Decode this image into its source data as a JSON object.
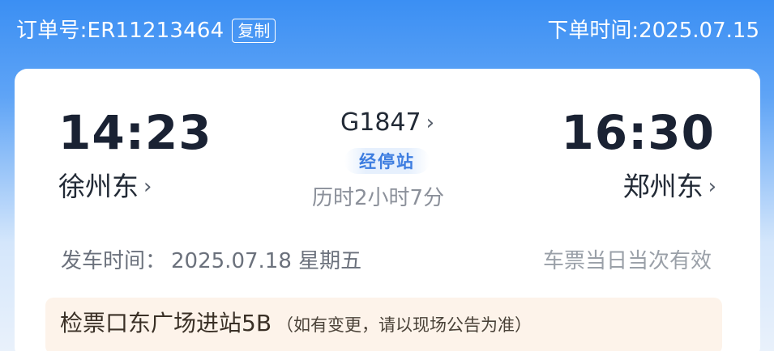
{
  "header": {
    "order_label": "订单号:ER11213464",
    "copy_label": "复制",
    "order_time": "下单时间:2025.07.15"
  },
  "trip": {
    "departure_time": "14:23",
    "departure_station": "徐州东",
    "arrival_time": "16:30",
    "arrival_station": "郑州东",
    "train_number": "G1847",
    "stops_label": "经停站",
    "duration": "历时2小时7分"
  },
  "details": {
    "depart_label": "发车时间：",
    "depart_date": "2025.07.18 星期五",
    "validity": "车票当日当次有效"
  },
  "gate": {
    "main": "检票口东广场进站5B",
    "note": "（如有变更，请以现场公告为准）"
  },
  "icons": {
    "chevron": "›"
  },
  "colors": {
    "header_blue": "#3b8ff3",
    "accent_blue": "#3d7de0",
    "gate_bg": "#fdf3ea"
  }
}
